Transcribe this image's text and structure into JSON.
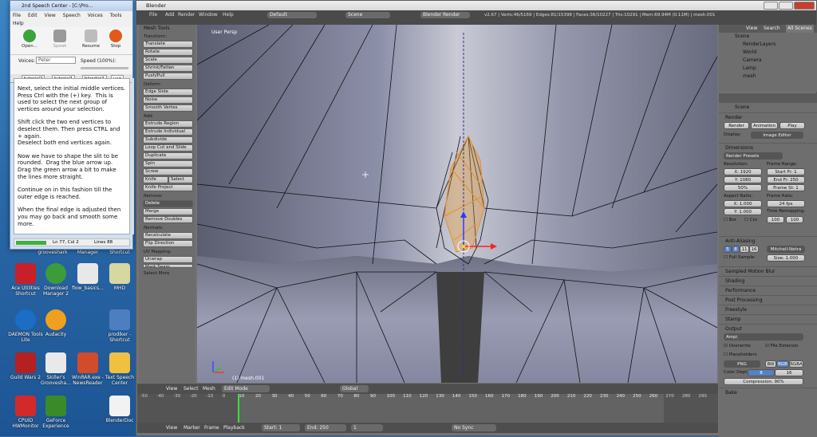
{
  "desktop": {
    "icons": [
      {
        "label": "Ace Utilities Shortcut"
      },
      {
        "label": "Download Manager 2"
      },
      {
        "label": "flow_basics..."
      },
      {
        "label": "MHD"
      },
      {
        "label": "DAEMON Tools Lite"
      },
      {
        "label": "Audacity"
      },
      {
        "label": "prodiker - Shortcut"
      },
      {
        "label": "Guild Wars 2"
      },
      {
        "label": "Skiller's Groovesha..."
      },
      {
        "label": "WinRAR.exe - NewsReader"
      },
      {
        "label": "Text Speech Center"
      },
      {
        "label": "CPUID HWMonitor"
      },
      {
        "label": "GeForce Experience"
      },
      {
        "label": "BlenderDoc"
      }
    ],
    "hidden_labels": [
      "grooveshark",
      "Manager",
      "Shortcut"
    ]
  },
  "speech_center": {
    "title": "2nd Speech Center - [C:\\Pro...",
    "menu": [
      "File",
      "Edit",
      "View",
      "Speech",
      "Voices",
      "Tools",
      "Help"
    ],
    "toolbar": [
      {
        "label": "Open...",
        "color": "#3aa33a"
      },
      {
        "label": "Speak",
        "color": "#8a8a8a"
      },
      {
        "label": "Resume",
        "color": "#999999"
      },
      {
        "label": "Stop",
        "color": "#e05a1a"
      }
    ],
    "voices_label": "Voices:",
    "voice_value": "Peter",
    "speed_label": "Speed (100%):",
    "tabs": [
      "tutorial2",
      "tutorial1",
      "blender2",
      "vag"
    ],
    "paragraphs": [
      "Next, select the initial middle vertices.\nPress Ctrl with the (+) key.  This is used to select the next group of vertices around your selection.",
      "Shift click the two end vertices to deselect them. Then press CTRL and + again.\nDeselect both end vertices again.",
      "Now we have to shape the slit to be rounded.  Drag the blue arrow up. Drag the green arrow a bit to make the lines more straight.",
      "Continue on in this fashion till the outer edge is reached.",
      "When the final edge is adjusted then you may go back and smooth some more."
    ],
    "status_position": "Ln 77, Col 2",
    "status_lines": "Lines 88"
  },
  "blender": {
    "title": "Blender",
    "info_menu": [
      "File",
      "Add",
      "Render",
      "Window",
      "Help"
    ],
    "layout": "Default",
    "scene": "Scene",
    "engine": "Blender Render",
    "stats": "v2.67 | Verts:46/5169 | Edges:81/15398 | Faces:36/10227 | Tris:10291 | Mem:69.94M (0.11M) | mesh.001",
    "tool_shelf": {
      "header": "Mesh Tools",
      "transform_label": "Transform:",
      "transform": [
        "Translate",
        "Rotate",
        "Scale",
        "Shrink/Fatten",
        "Push/Pull"
      ],
      "deform_label": "Deform:",
      "deform": [
        "Edge Slide",
        "Noise",
        "Smooth Vertex"
      ],
      "add_label": "Add:",
      "add": [
        "Extrude Region",
        "Extrude Individual",
        "Subdivide",
        "Loop Cut and Slide",
        "Duplicate",
        "Spin",
        "Screw"
      ],
      "knife": "Knife",
      "select": "Select",
      "knife_project": "Knife Project",
      "remove_label": "Remove:",
      "delete": "Delete",
      "remove": [
        "Merge",
        "Remove Doubles"
      ],
      "normals_label": "Normals:",
      "normals": [
        "Recalculate",
        "Flip Direction"
      ],
      "uv_label": "UV Mapping:",
      "uv": [
        "Unwrap",
        "Mark Seam"
      ],
      "more": "Select More"
    },
    "viewport": {
      "label": "User Persp",
      "object": "(1) mesh.001"
    },
    "viewport_header": {
      "items": [
        "View",
        "Select",
        "Mesh"
      ],
      "mode": "Edit Mode",
      "orientation": "Global"
    },
    "timeline_ticks": [
      "-50",
      "-40",
      "-30",
      "-20",
      "-10",
      "0",
      "10",
      "20",
      "30",
      "40",
      "50",
      "60",
      "70",
      "80",
      "90",
      "100",
      "110",
      "120",
      "130",
      "140",
      "150",
      "160",
      "170",
      "180",
      "190",
      "200",
      "210",
      "220",
      "230",
      "240",
      "250",
      "260",
      "270",
      "280",
      "290"
    ],
    "timeline_header": {
      "items": [
        "View",
        "Marker",
        "Frame",
        "Playback"
      ],
      "start": "Start: 1",
      "end": "End: 250",
      "current": "1",
      "sync": "No Sync"
    },
    "outliner": {
      "header": [
        "View",
        "Search",
        "All Scenes"
      ],
      "rows": [
        "Scene",
        "RenderLayers",
        "World",
        "Camera",
        "Lamp",
        "mesh"
      ]
    },
    "properties": {
      "breadcrumb": "Scene",
      "render_section": "Render",
      "render_btn": "Render",
      "animation_btn": "Animation",
      "play_btn": "Play",
      "display_label": "Display:",
      "display_value": "Image Editor",
      "dimensions_section": "Dimensions",
      "presets": "Render Presets",
      "resolution_label": "Resolution:",
      "res_x": "X: 1920",
      "res_y": "Y: 1080",
      "res_pct": "50%",
      "frame_range_label": "Frame Range:",
      "start_frame": "Start Fr: 1",
      "end_frame": "End Fr: 250",
      "frame_step": "Frame St: 1",
      "aspect_label": "Aspect Ratio:",
      "aspect_x": "X: 1.000",
      "aspect_y": "Y: 1.000",
      "frame_rate_label": "Frame Rate:",
      "fps": "24 fps",
      "time_remap_label": "Time Remapping:",
      "remap_old": "100",
      "remap_new": "100",
      "border_label": "Bor",
      "crop_label": "Cro",
      "aa_section": "Anti-Aliasing",
      "aa_samples": [
        "5",
        "8",
        "11",
        "16"
      ],
      "aa_filter": "Mitchell-Netra",
      "full_sample": "Full Sample",
      "size": "Size: 1.000",
      "collapsed": [
        "Sampled Motion Blur",
        "Shading",
        "Performance",
        "Post Processing",
        "Freestyle",
        "Stamp"
      ],
      "output_section": "Output",
      "output_path": "Amp\\",
      "overwrite": "Overwrite",
      "file_ext": "File Extensio",
      "placeholders": "Placeholders",
      "format": "PNG",
      "color_modes": [
        "BW",
        "RGB",
        "RGBA"
      ],
      "color_depth_label": "Color Dept",
      "color_depth": [
        "8",
        "16"
      ],
      "compression": "Compression: 90%",
      "bake_section": "Bake"
    }
  }
}
